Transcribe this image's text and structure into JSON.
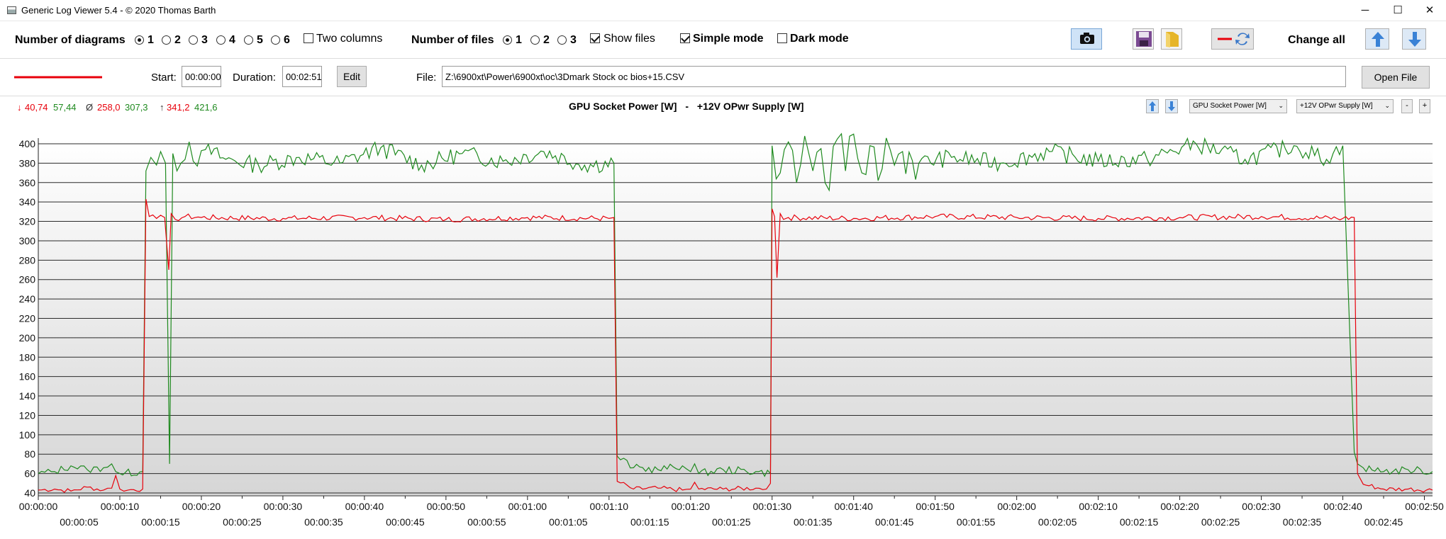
{
  "window": {
    "title": "Generic Log Viewer 5.4 - © 2020 Thomas Barth",
    "minimize": "─",
    "maximize": "☐",
    "close": "✕"
  },
  "toolbar": {
    "num_diagrams_label": "Number of diagrams",
    "diagram_options": [
      "1",
      "2",
      "3",
      "4",
      "5",
      "6"
    ],
    "diagram_selected": "1",
    "two_columns_label": "Two columns",
    "two_columns_checked": false,
    "num_files_label": "Number of files",
    "file_options": [
      "1",
      "2",
      "3"
    ],
    "file_selected": "1",
    "show_files_label": "Show files",
    "show_files_checked": true,
    "simple_mode_label": "Simple mode",
    "simple_mode_checked": true,
    "dark_mode_label": "Dark mode",
    "dark_mode_checked": false,
    "change_all_label": "Change all",
    "icons": [
      "camera-icon",
      "save-icon",
      "folder-icon",
      "line-swap-icon",
      "arrow-up-icon",
      "arrow-down-icon"
    ]
  },
  "fileline": {
    "start_label": "Start:",
    "start_value": "00:00:00",
    "duration_label": "Duration:",
    "duration_value": "00:02:51",
    "edit_label": "Edit",
    "file_label": "File:",
    "file_path": "Z:\\6900xt\\Power\\6900xt\\oc\\3Dmark Stock oc bios+15.CSV",
    "open_file_label": "Open File",
    "line_color": "#e8000b"
  },
  "stats": {
    "min_symbol": "↓",
    "min_red": "40,74",
    "min_green": "57,44",
    "avg_symbol": "Ø",
    "avg_red": "258,0",
    "avg_green": "307,3",
    "max_symbol": "↑",
    "max_red": "341,2",
    "max_green": "421,6"
  },
  "chart_header": {
    "title_a": "GPU Socket Power [W]",
    "separator": "-",
    "title_b": "+12V OPwr Supply [W]",
    "combo_a": "GPU Socket Power [W]",
    "combo_b": "+12V OPwr Supply [W]",
    "minus_label": "-",
    "plus_label": "+",
    "color_a": "#e8000b",
    "color_b": "#1f8a1f"
  },
  "chart_data": {
    "type": "line",
    "title": "GPU Socket Power [W] - +12V OPwr Supply [W]",
    "xlabel": "",
    "ylabel": "",
    "ylim": [
      40,
      410
    ],
    "xlim_seconds": [
      0,
      171
    ],
    "y_ticks": [
      40,
      60,
      80,
      100,
      120,
      140,
      160,
      180,
      200,
      220,
      240,
      260,
      280,
      300,
      320,
      340,
      360,
      380,
      400
    ],
    "x_ticks_upper": [
      "00:00:00",
      "00:00:10",
      "00:00:20",
      "00:00:30",
      "00:00:40",
      "00:00:50",
      "00:01:00",
      "00:01:10",
      "00:01:20",
      "00:01:30",
      "00:01:40",
      "00:01:50",
      "00:02:00",
      "00:02:10",
      "00:02:20",
      "00:02:30",
      "00:02:40",
      "00:02:50"
    ],
    "x_ticks_lower": [
      "00:00:05",
      "00:00:15",
      "00:00:25",
      "00:00:35",
      "00:00:45",
      "00:00:55",
      "00:01:05",
      "00:01:15",
      "00:01:25",
      "00:01:35",
      "00:01:45",
      "00:01:55",
      "00:02:05",
      "00:02:15",
      "00:02:25",
      "00:02:35",
      "00:02:45"
    ],
    "grid": true,
    "series": [
      {
        "name": "GPU Socket Power [W]",
        "color": "#e8000b",
        "x": [
          0,
          2,
          4,
          6,
          8,
          9,
          9.5,
          10,
          11,
          12.8,
          13.2,
          13.6,
          14.5,
          15.5,
          16,
          16.3,
          16.8,
          18,
          20,
          30,
          40,
          50,
          60,
          70,
          70.6,
          71,
          73,
          76,
          79,
          80,
          80.5,
          81,
          84,
          88,
          89.3,
          89.8,
          90,
          90.3,
          90.6,
          91,
          91.4,
          92,
          100,
          110,
          120,
          130,
          140,
          150,
          160,
          161.4,
          161.8,
          162.5,
          165,
          168,
          171
        ],
        "values": [
          43,
          44,
          42,
          46,
          43,
          45,
          58,
          44,
          43,
          44,
          343,
          325,
          323,
          324,
          270,
          328,
          322,
          325,
          324,
          323,
          324,
          322,
          324,
          323,
          324,
          52,
          44,
          45,
          43,
          44,
          51,
          44,
          44,
          45,
          44,
          50,
          333,
          325,
          262,
          328,
          322,
          324,
          323,
          325,
          324,
          323,
          324,
          325,
          323,
          324,
          60,
          49,
          44,
          44,
          43
        ]
      },
      {
        "name": "+12V OPwr Supply [W]",
        "color": "#1f8a1f",
        "x": [
          0,
          2,
          4,
          6,
          8,
          9,
          9.5,
          10,
          12.8,
          13.2,
          13.8,
          14.5,
          15,
          15.6,
          16.1,
          16.5,
          17,
          17.5,
          18.5,
          19.5,
          20.5,
          23,
          27,
          32,
          37,
          42,
          47,
          52,
          57,
          62,
          67,
          70.6,
          71,
          73,
          76,
          79,
          80,
          80.5,
          81,
          84,
          88,
          89.8,
          90,
          91,
          92,
          93,
          94,
          95,
          96,
          97,
          98,
          99,
          100,
          101,
          102,
          103,
          104,
          105,
          106,
          108,
          112,
          118,
          124,
          130,
          136,
          142,
          148,
          154,
          158,
          160,
          161.4,
          161.8,
          162.5,
          165,
          168,
          171
        ],
        "values": [
          60,
          62,
          68,
          64,
          66,
          70,
          62,
          60,
          62,
          372,
          386,
          378,
          392,
          380,
          70,
          390,
          372,
          380,
          402,
          377,
          394,
          384,
          378,
          386,
          380,
          396,
          378,
          390,
          382,
          392,
          378,
          380,
          78,
          66,
          64,
          68,
          62,
          70,
          60,
          64,
          62,
          60,
          398,
          370,
          402,
          360,
          408,
          372,
          395,
          352,
          405,
          372,
          410,
          370,
          398,
          362,
          406,
          378,
          392,
          380,
          386,
          380,
          392,
          382,
          384,
          400,
          384,
          398,
          384,
          398,
          82,
          70,
          66,
          62,
          64,
          62
        ]
      }
    ]
  }
}
